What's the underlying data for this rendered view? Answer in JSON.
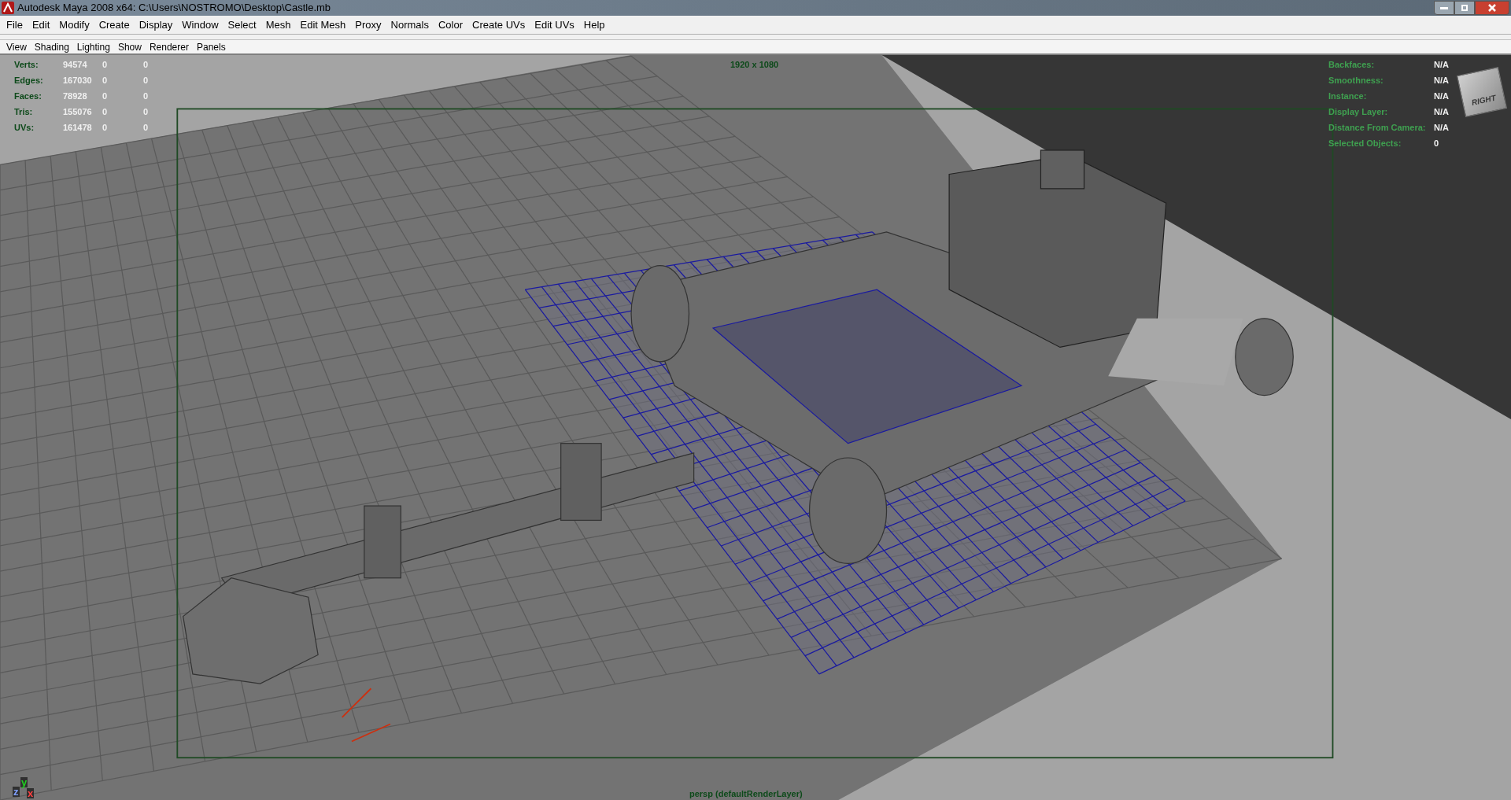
{
  "window": {
    "title": "Autodesk Maya 2008 x64: C:\\Users\\NOSTROMO\\Desktop\\Castle.mb"
  },
  "menu_bar": [
    "File",
    "Edit",
    "Modify",
    "Create",
    "Display",
    "Window",
    "Select",
    "Mesh",
    "Edit Mesh",
    "Proxy",
    "Normals",
    "Color",
    "Create UVs",
    "Edit UVs",
    "Help"
  ],
  "panel_menu": [
    "View",
    "Shading",
    "Lighting",
    "Show",
    "Renderer",
    "Panels"
  ],
  "viewport": {
    "resolution": "1920 x 1080",
    "stats": [
      {
        "label": "Verts:",
        "values": [
          "94574",
          "0",
          "0"
        ]
      },
      {
        "label": "Edges:",
        "values": [
          "167030",
          "0",
          "0"
        ]
      },
      {
        "label": "Faces:",
        "values": [
          "78928",
          "0",
          "0"
        ]
      },
      {
        "label": "Tris:",
        "values": [
          "155076",
          "0",
          "0"
        ]
      },
      {
        "label": "UVs:",
        "values": [
          "161478",
          "0",
          "0"
        ]
      }
    ],
    "info": [
      {
        "label": "Backfaces:",
        "value": "N/A"
      },
      {
        "label": "Smoothness:",
        "value": "N/A"
      },
      {
        "label": "Instance:",
        "value": "N/A"
      },
      {
        "label": "Display Layer:",
        "value": "N/A"
      },
      {
        "label": "Distance From Camera:",
        "value": "N/A"
      },
      {
        "label": "Selected Objects:",
        "value": "0"
      }
    ],
    "view_cube": {
      "face": "RIGHT"
    },
    "axes": [
      {
        "kind": "x",
        "label": "x"
      },
      {
        "kind": "y",
        "label": "y"
      },
      {
        "kind": "z",
        "label": "z"
      }
    ],
    "camera": "persp (defaultRenderLayer)"
  }
}
